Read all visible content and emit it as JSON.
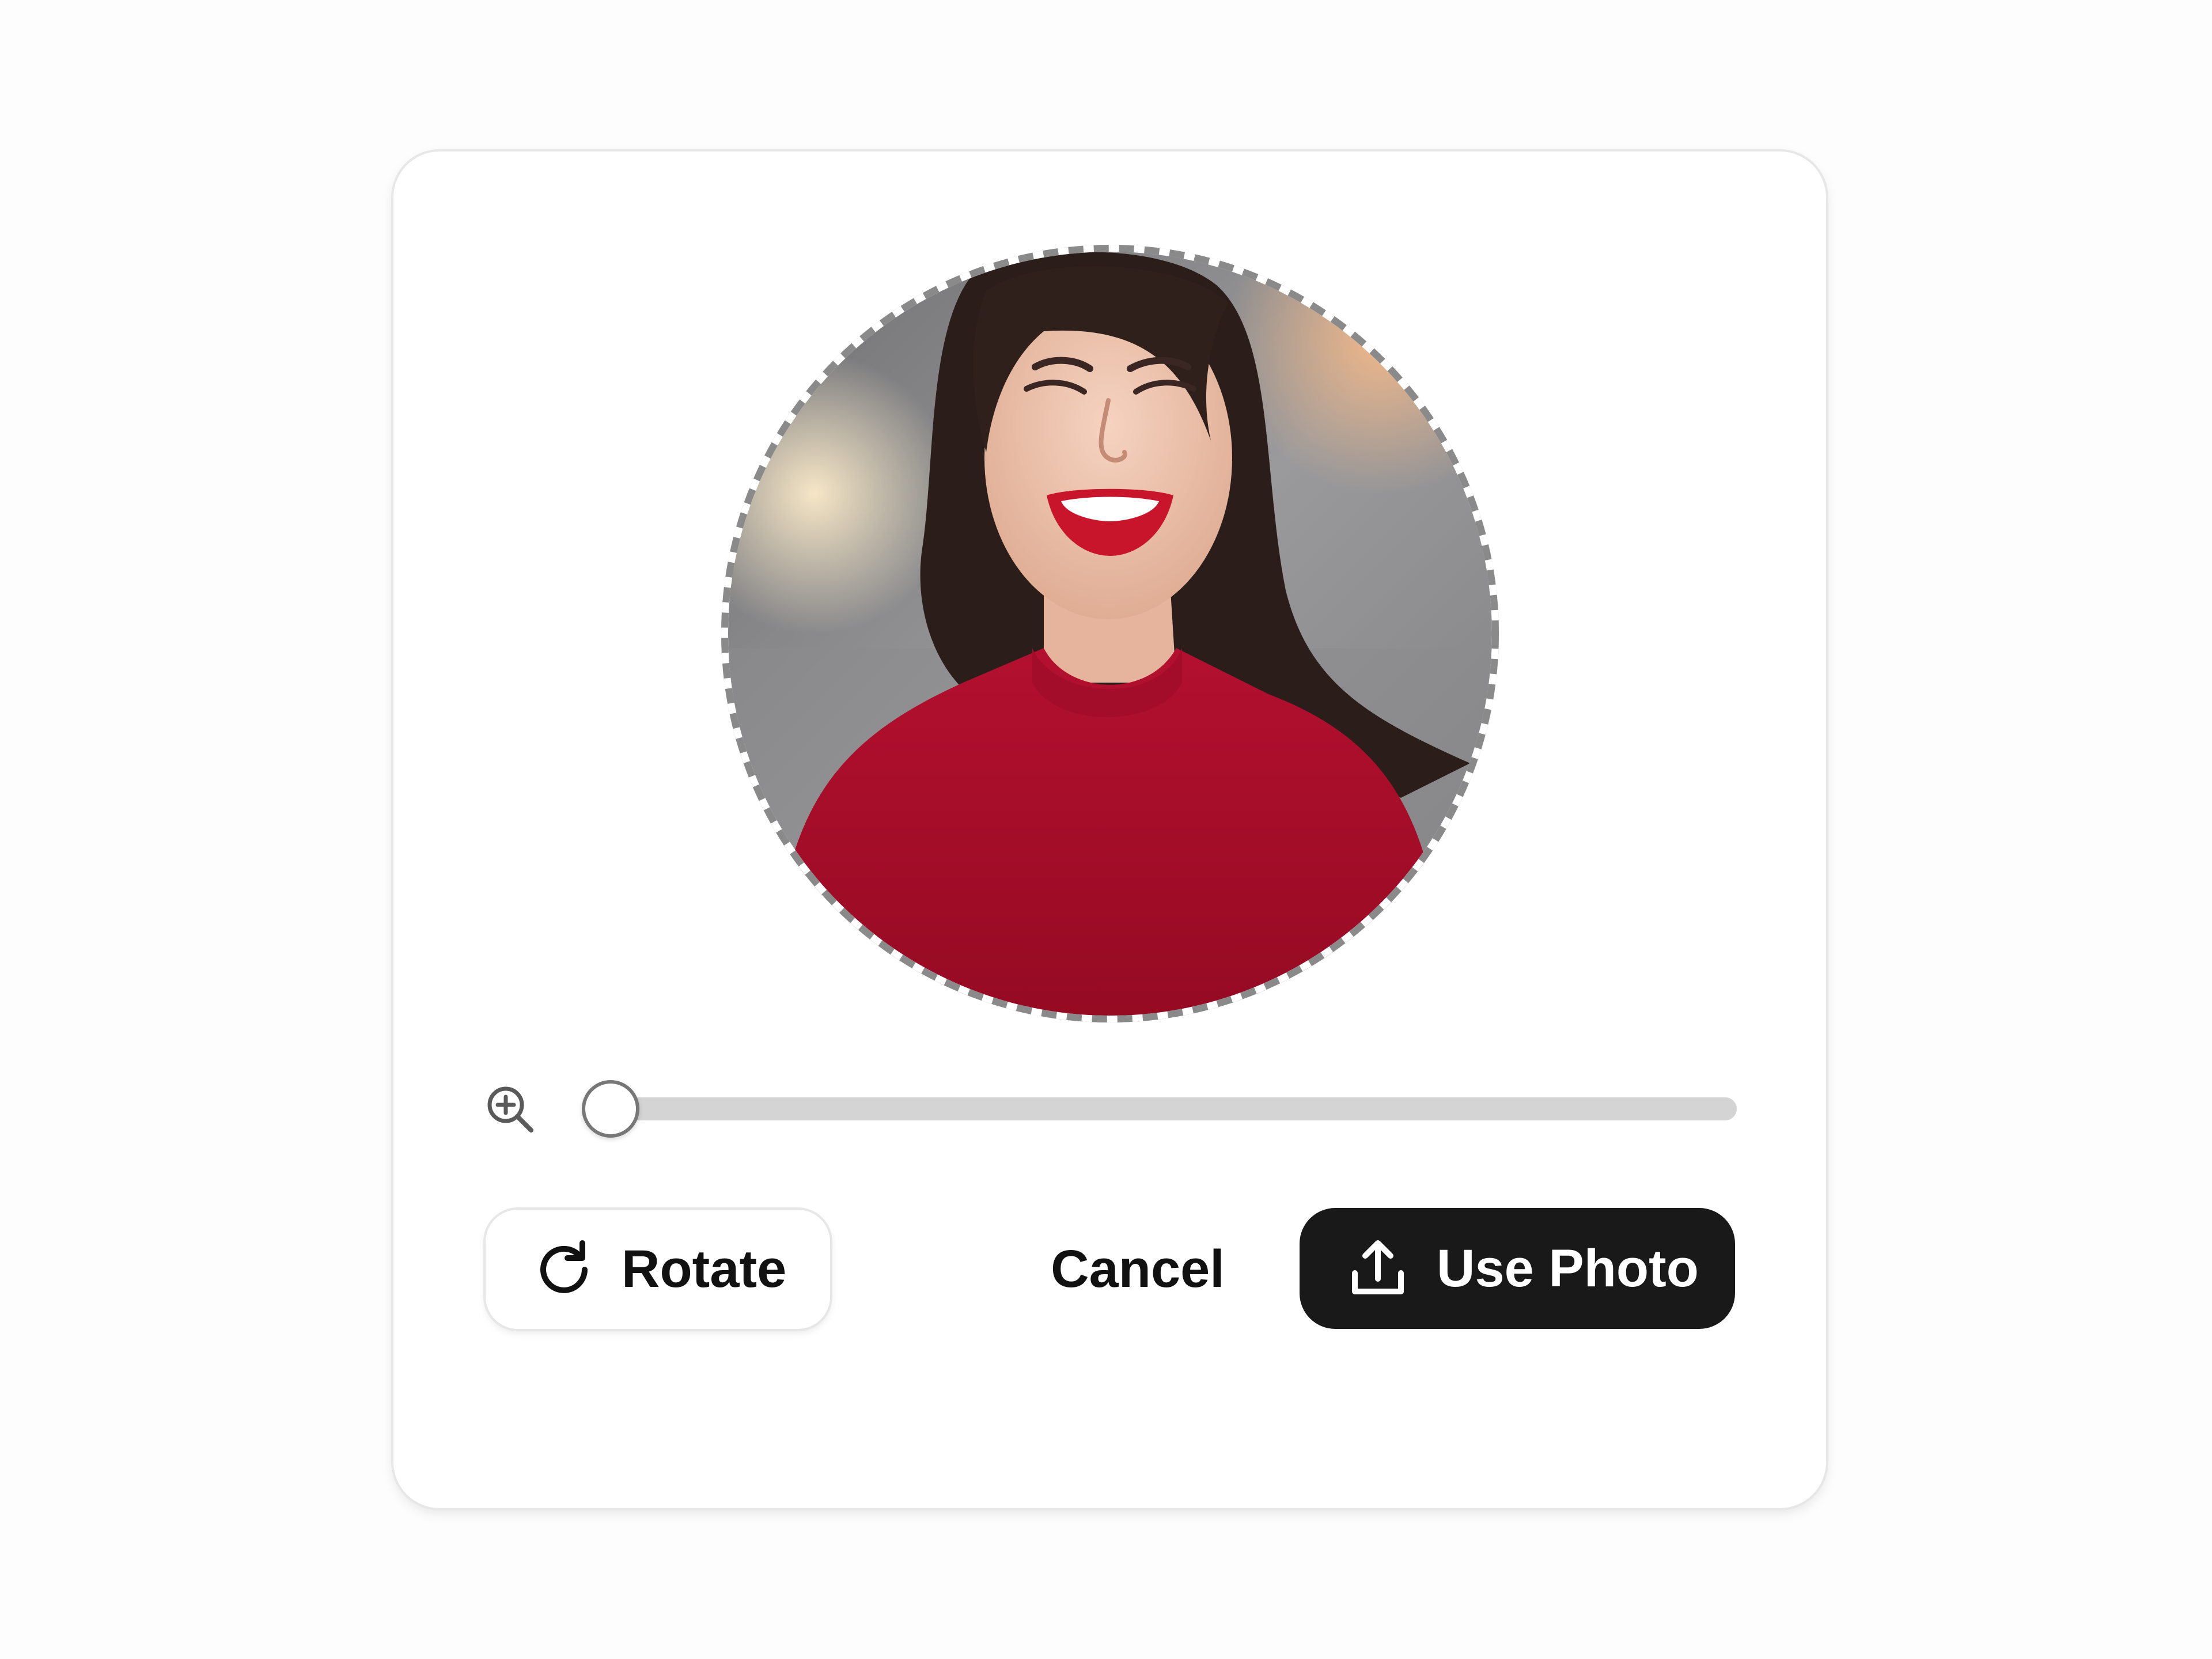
{
  "dialog": {
    "zoom": {
      "icon": "zoom-in-icon",
      "value": 0
    },
    "actions": {
      "rotate_label": "Rotate",
      "rotate_icon": "rotate-clockwise-icon",
      "cancel_label": "Cancel",
      "use_photo_label": "Use Photo",
      "use_photo_icon": "upload-icon"
    }
  },
  "colors": {
    "primary_button": "#191919",
    "slider_track": "#d4d4d4",
    "crop_ring": "#8a8a8a"
  }
}
